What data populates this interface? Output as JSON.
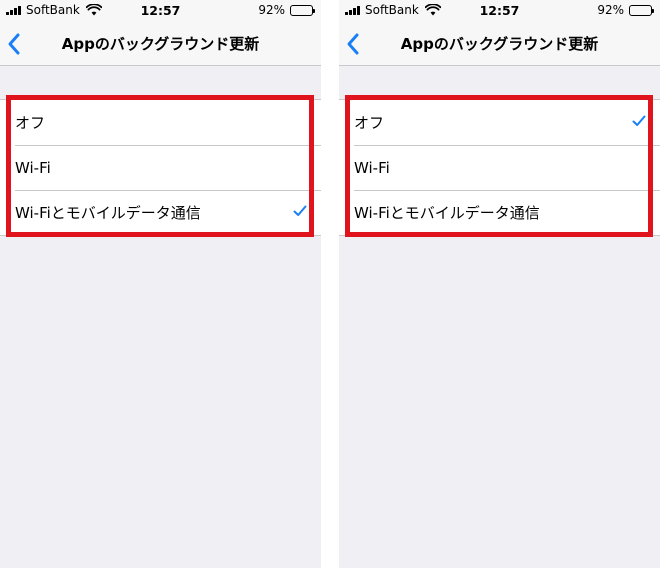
{
  "colors": {
    "accent": "#1a7ff5",
    "highlight": "#e0141c",
    "background": "#efeff4"
  },
  "screens": [
    {
      "status": {
        "carrier": "SoftBank",
        "time": "12:57",
        "battery": "92%",
        "battery_level": 0.92
      },
      "nav": {
        "title": "Appのバックグラウンド更新",
        "back_icon": "chevron-left-icon"
      },
      "options": [
        {
          "label": "オフ",
          "selected": false
        },
        {
          "label": "Wi-Fi",
          "selected": false
        },
        {
          "label": "Wi-Fiとモバイルデータ通信",
          "selected": true
        }
      ]
    },
    {
      "status": {
        "carrier": "SoftBank",
        "time": "12:57",
        "battery": "92%",
        "battery_level": 0.92
      },
      "nav": {
        "title": "Appのバックグラウンド更新",
        "back_icon": "chevron-left-icon"
      },
      "options": [
        {
          "label": "オフ",
          "selected": true
        },
        {
          "label": "Wi-Fi",
          "selected": false
        },
        {
          "label": "Wi-Fiとモバイルデータ通信",
          "selected": false
        }
      ]
    }
  ]
}
